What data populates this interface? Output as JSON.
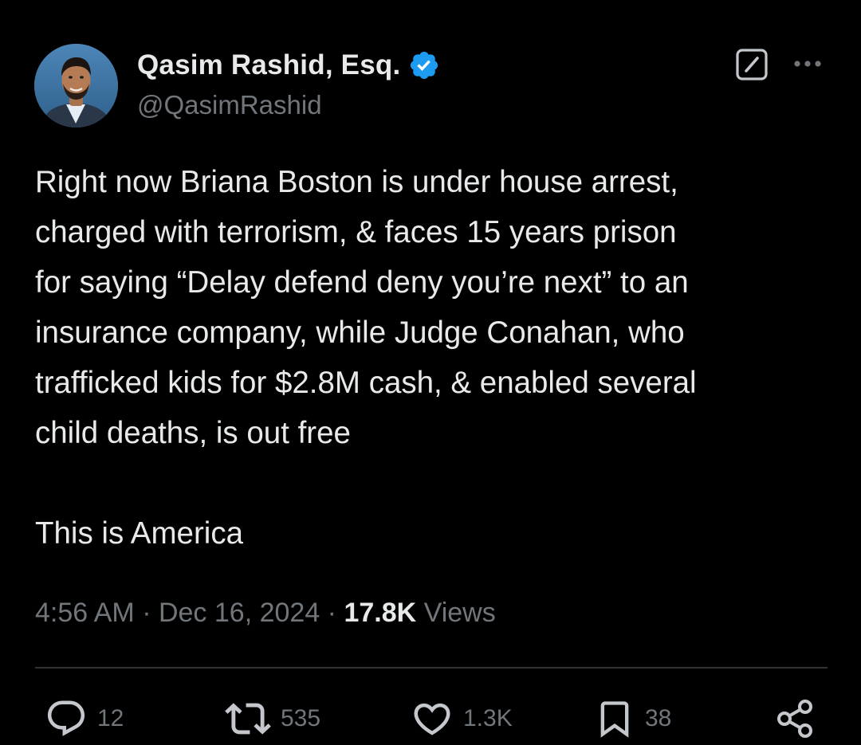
{
  "author": {
    "display_name": "Qasim Rashid, Esq.",
    "handle": "@QasimRashid",
    "verified": true
  },
  "colors": {
    "background": "#000000",
    "text": "#e7e9ea",
    "secondary": "#71767b",
    "verified_badge": "#1d9bf0",
    "divider": "#2f3336"
  },
  "icons": {
    "verified": "verified-badge-icon",
    "grok": "grok-icon",
    "more": "more-options-icon",
    "reply": "reply-icon",
    "repost": "repost-icon",
    "like": "like-icon",
    "bookmark": "bookmark-icon",
    "share": "share-icon"
  },
  "tweet": {
    "lines": [
      "Right now Briana Boston is under house arrest,",
      "charged with terrorism, & faces 15 years prison",
      "for saying “Delay defend deny you’re next” to an",
      "insurance company, while Judge Conahan, who",
      "trafficked kids for $2.8M cash, & enabled several",
      "child deaths, is out free"
    ],
    "closing": "This is America"
  },
  "meta": {
    "time": "4:56 AM",
    "separator": " · ",
    "date": "Dec 16, 2024",
    "views_count": "17.8K",
    "views_label": "Views"
  },
  "actions": {
    "replies": "12",
    "reposts": "535",
    "likes": "1.3K",
    "bookmarks": "38"
  }
}
